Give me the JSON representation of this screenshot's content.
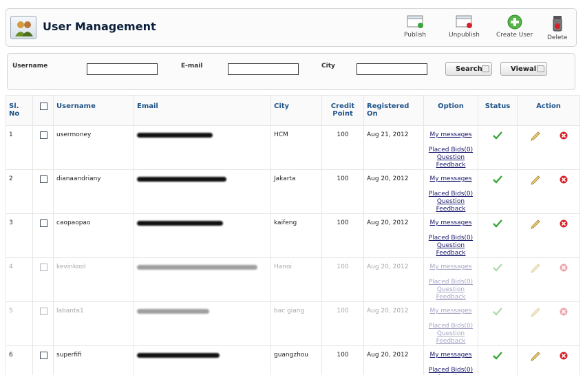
{
  "header": {
    "title": "User Management",
    "tools": [
      {
        "label": "Publish",
        "icon": "publish-icon"
      },
      {
        "label": "Unpublish",
        "icon": "unpublish-icon"
      },
      {
        "label": "Create User",
        "icon": "create-user-icon"
      },
      {
        "label": "Delete",
        "icon": "trash-icon"
      }
    ]
  },
  "filter": {
    "username_label": "Username",
    "email_label": "E-mail",
    "city_label": "City",
    "search_label": "Search",
    "viewall_label": "Viewall",
    "username_value": "",
    "email_value": "",
    "city_value": ""
  },
  "table": {
    "columns": [
      "Sl. No",
      "",
      "Username",
      "Email",
      "City",
      "Credit Point",
      "Registered On",
      "Option",
      "Status",
      "Action"
    ],
    "options": {
      "messages": "My messages",
      "bids": "Placed Bids(0)",
      "question": "Question",
      "feedback": "Feedback"
    },
    "rows": [
      {
        "no": "1",
        "username": "usermoney",
        "city": "HCM",
        "credit": "100",
        "registered": "Aug 21, 2012",
        "faded": false
      },
      {
        "no": "2",
        "username": "dianaandriany",
        "city": "Jakarta",
        "credit": "100",
        "registered": "Aug 20, 2012",
        "faded": false
      },
      {
        "no": "3",
        "username": "caopaopao",
        "city": "kaifeng",
        "credit": "100",
        "registered": "Aug 20, 2012",
        "faded": false
      },
      {
        "no": "4",
        "username": "kevinkool",
        "city": "Hanoi",
        "credit": "100",
        "registered": "Aug 20, 2012",
        "faded": true
      },
      {
        "no": "5",
        "username": "labanta1",
        "city": "bac giang",
        "credit": "100",
        "registered": "Aug 20, 2012",
        "faded": true
      },
      {
        "no": "6",
        "username": "superfifi",
        "city": "guangzhou",
        "credit": "100",
        "registered": "Aug 20, 2012",
        "faded": false
      }
    ]
  },
  "colors": {
    "accent": "#1f5489",
    "credit": "#8b1a1a",
    "title": "#0b1f3a",
    "check": "#3aa53a",
    "delete": "#d8202a"
  }
}
